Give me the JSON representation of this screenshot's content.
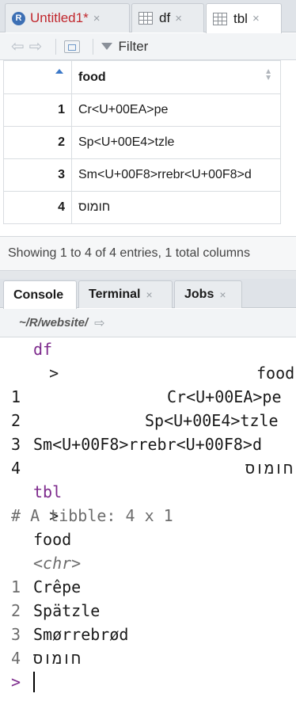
{
  "editor_tabs": [
    {
      "label": "Untitled1*",
      "close": "×"
    },
    {
      "label": "df",
      "close": "×"
    },
    {
      "label": "tbl",
      "close": "×"
    }
  ],
  "toolbar": {
    "filter_label": "Filter"
  },
  "table": {
    "column_header": "food",
    "rows": [
      {
        "index": "1",
        "food": "Cr<U+00EA>pe"
      },
      {
        "index": "2",
        "food": "Sp<U+00E4>tzle"
      },
      {
        "index": "3",
        "food": "Sm<U+00F8>rrebr<U+00F8>d"
      },
      {
        "index": "4",
        "food": "חומוס"
      }
    ],
    "status": "Showing 1 to 4 of 4 entries, 1 total columns"
  },
  "console_tabs": [
    {
      "label": "Console"
    },
    {
      "label": "Terminal",
      "close": "×"
    },
    {
      "label": "Jobs",
      "close": "×"
    }
  ],
  "working_dir": "~/R/website/",
  "console": {
    "prompt": ">",
    "cmd1": "df",
    "df_header": "food",
    "df_rows": [
      {
        "index": "1",
        "value": "Cr<U+00EA>pe"
      },
      {
        "index": "2",
        "value": "Sp<U+00E4>tzle"
      },
      {
        "index": "3",
        "value": "Sm<U+00F8>rrebr<U+00F8>d"
      },
      {
        "index": "4",
        "value": "חומוס"
      }
    ],
    "cmd2": "tbl",
    "tibble_comment": "# A tibble: 4 x 1",
    "tibble_col": "food",
    "tibble_type": "<chr>",
    "tibble_rows": [
      {
        "index": "1",
        "value": "Crêpe"
      },
      {
        "index": "2",
        "value": "Spätzle"
      },
      {
        "index": "3",
        "value": "Smørrebrød"
      },
      {
        "index": "4",
        "value": "חומוס"
      }
    ]
  }
}
